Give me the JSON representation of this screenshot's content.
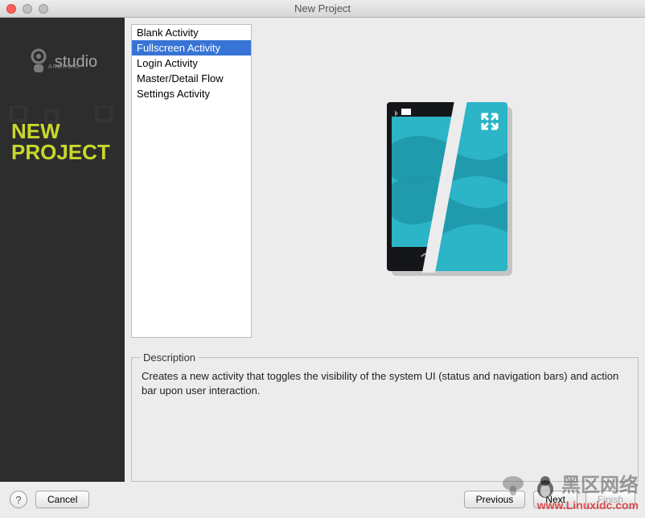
{
  "window": {
    "title": "New Project"
  },
  "sidebar": {
    "brand_small": "ANDROID",
    "brand_large": "studio",
    "heading_line1": "NEW",
    "heading_line2": "PROJECT"
  },
  "activities": {
    "items": [
      {
        "label": "Blank Activity",
        "selected": false
      },
      {
        "label": "Fullscreen Activity",
        "selected": true
      },
      {
        "label": "Login Activity",
        "selected": false
      },
      {
        "label": "Master/Detail Flow",
        "selected": false
      },
      {
        "label": "Settings Activity",
        "selected": false
      }
    ]
  },
  "description": {
    "label": "Description",
    "text": "Creates a new activity that toggles the visibility of the system UI (status and navigation bars) and action bar upon user interaction."
  },
  "footer": {
    "help": "?",
    "cancel": "Cancel",
    "previous": "Previous",
    "next": "Next",
    "finish": "Finish"
  },
  "preview": {
    "accent": "#2cb4c7",
    "dark": "#15161a",
    "expand_icon": "expand-icon"
  },
  "watermark": {
    "line1": "黑区网络",
    "line2": "www.Linuxidc.com"
  }
}
